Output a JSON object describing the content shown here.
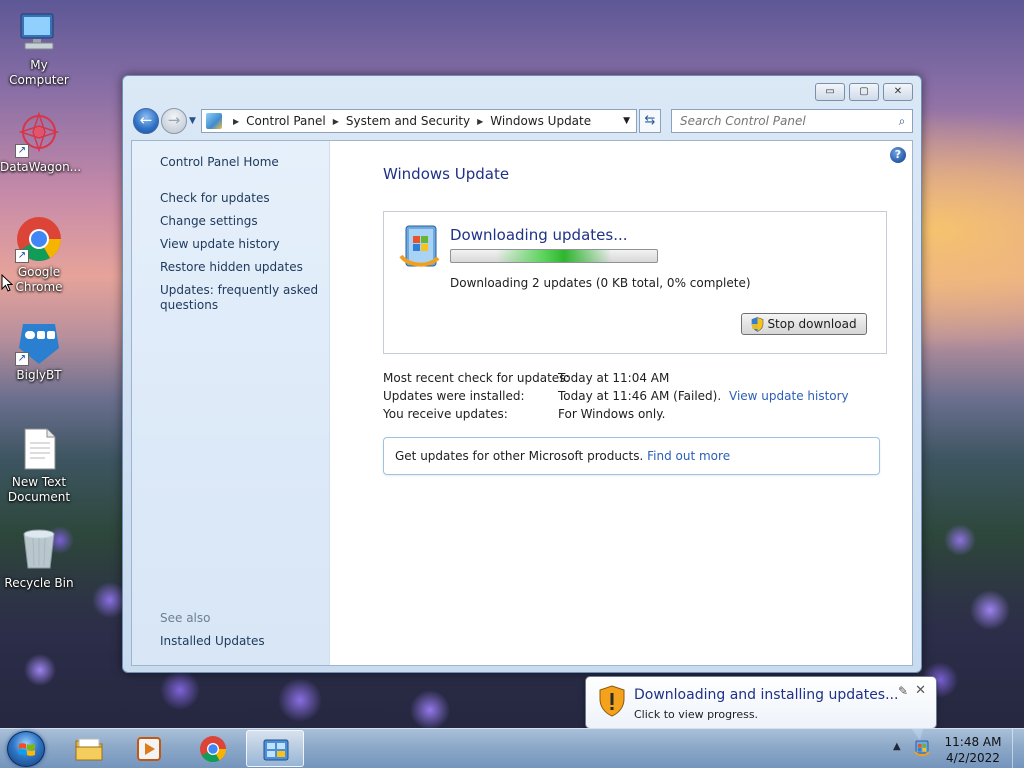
{
  "desktop": {
    "icons": [
      {
        "label": "My Computer"
      },
      {
        "label": "DataWagon..."
      },
      {
        "label": "Google Chrome"
      },
      {
        "label": "BiglyBT"
      },
      {
        "label": "New Text Document"
      },
      {
        "label": "Recycle Bin"
      }
    ]
  },
  "window": {
    "title_buttons": {
      "minimize": "▭",
      "maximize": "▢",
      "close": "✕"
    },
    "breadcrumb": [
      "Control Panel",
      "System and Security",
      "Windows Update"
    ],
    "search_placeholder": "Search Control Panel",
    "left_pane": {
      "home": "Control Panel Home",
      "links": [
        "Check for updates",
        "Change settings",
        "View update history",
        "Restore hidden updates",
        "Updates: frequently asked questions"
      ],
      "see_also_heading": "See also",
      "see_also_links": [
        "Installed Updates"
      ]
    },
    "main": {
      "title": "Windows Update",
      "status": {
        "heading": "Downloading updates...",
        "detail": "Downloading 2 updates (0 KB total, 0% complete)",
        "progress_percent": 0,
        "stop_button": "Stop download"
      },
      "info": {
        "recent_check_label": "Most recent check for updates:",
        "recent_check_value": "Today at 11:04 AM",
        "installed_label": "Updates were installed:",
        "installed_value": "Today at 11:46 AM (Failed).",
        "installed_link": "View update history",
        "receive_label": "You receive updates:",
        "receive_value": "For Windows only."
      },
      "other_products": {
        "text": "Get updates for other Microsoft products.",
        "link": "Find out more"
      }
    }
  },
  "notification": {
    "title": "Downloading and installing updates...",
    "subtitle": "Click to view progress."
  },
  "taskbar": {
    "clock_time": "11:48 AM",
    "clock_date": "4/2/2022"
  },
  "colors": {
    "link": "#2c5eb8",
    "heading": "#1e3287",
    "progress": "#2fb52f"
  }
}
